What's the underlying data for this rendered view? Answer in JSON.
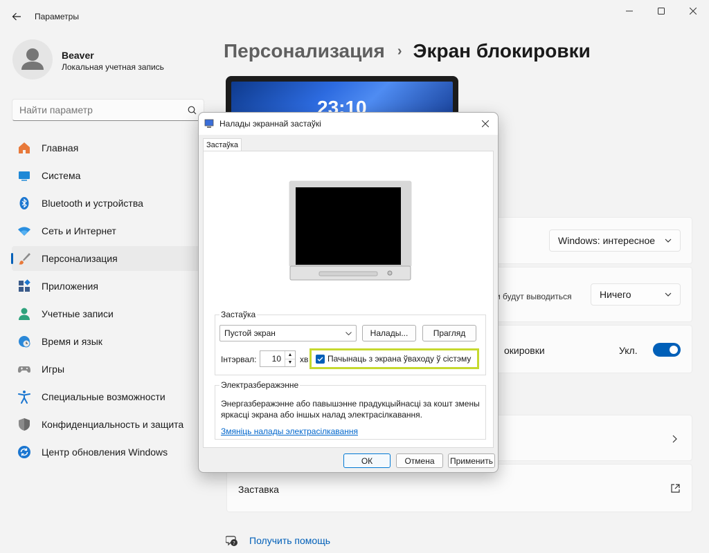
{
  "window": {
    "title": "Параметры"
  },
  "user": {
    "name": "Beaver",
    "account_type": "Локальная учетная запись"
  },
  "search": {
    "placeholder": "Найти параметр"
  },
  "nav": {
    "items": [
      {
        "label": "Главная",
        "icon": "home-icon"
      },
      {
        "label": "Система",
        "icon": "system-icon"
      },
      {
        "label": "Bluetooth и устройства",
        "icon": "bluetooth-icon"
      },
      {
        "label": "Сеть и Интернет",
        "icon": "wifi-icon"
      },
      {
        "label": "Персонализация",
        "icon": "brush-icon",
        "active": true
      },
      {
        "label": "Приложения",
        "icon": "apps-icon"
      },
      {
        "label": "Учетные записи",
        "icon": "accounts-icon"
      },
      {
        "label": "Время и язык",
        "icon": "time-language-icon"
      },
      {
        "label": "Игры",
        "icon": "gaming-icon"
      },
      {
        "label": "Специальные возможности",
        "icon": "accessibility-icon"
      },
      {
        "label": "Конфиденциальность и защита",
        "icon": "shield-icon"
      },
      {
        "label": "Центр обновления Windows",
        "icon": "update-icon"
      }
    ]
  },
  "breadcrumb": {
    "parent": "Персонализация",
    "separator": "›",
    "current": "Экран блокировки"
  },
  "preview": {
    "time": "23:10"
  },
  "settings": {
    "lockscreen_value": "Windows: интересное",
    "status_partial_text": "и будут выводиться",
    "status_value": "Ничего",
    "signin_partial_text": "окировки",
    "signin_state": "Укл.",
    "signin_on": true,
    "screensaver_label": "Заставка",
    "help_link": "Получить помощь"
  },
  "dialog": {
    "title": "Налады экраннай застаўкі",
    "tab": "Застаўка",
    "screensaver_group": "Застаўка",
    "screensaver_value": "Пустой экран",
    "settings_button": "Налады...",
    "preview_button": "Прагляд",
    "interval_label": "Інтэрвал:",
    "interval_value": "10",
    "interval_unit": "хв",
    "resume_checkbox": "Пачынаць з экрана ўваходу ў сістэму",
    "resume_checked": true,
    "power_group": "Электразберажэнне",
    "power_text_1": "Энергазберажэнне або павышэнне прадукцыйнасці за кошт змены",
    "power_text_2": "яркасці экрана або іншых налад электрасілкавання.",
    "power_link": "Змяніць налады электрасілкавання",
    "ok_button": "ОК",
    "cancel_button": "Отмена",
    "apply_button": "Применить"
  },
  "colors": {
    "accent": "#005fb8",
    "highlight_border": "#c6d92e",
    "background": "#f3f3f3"
  }
}
